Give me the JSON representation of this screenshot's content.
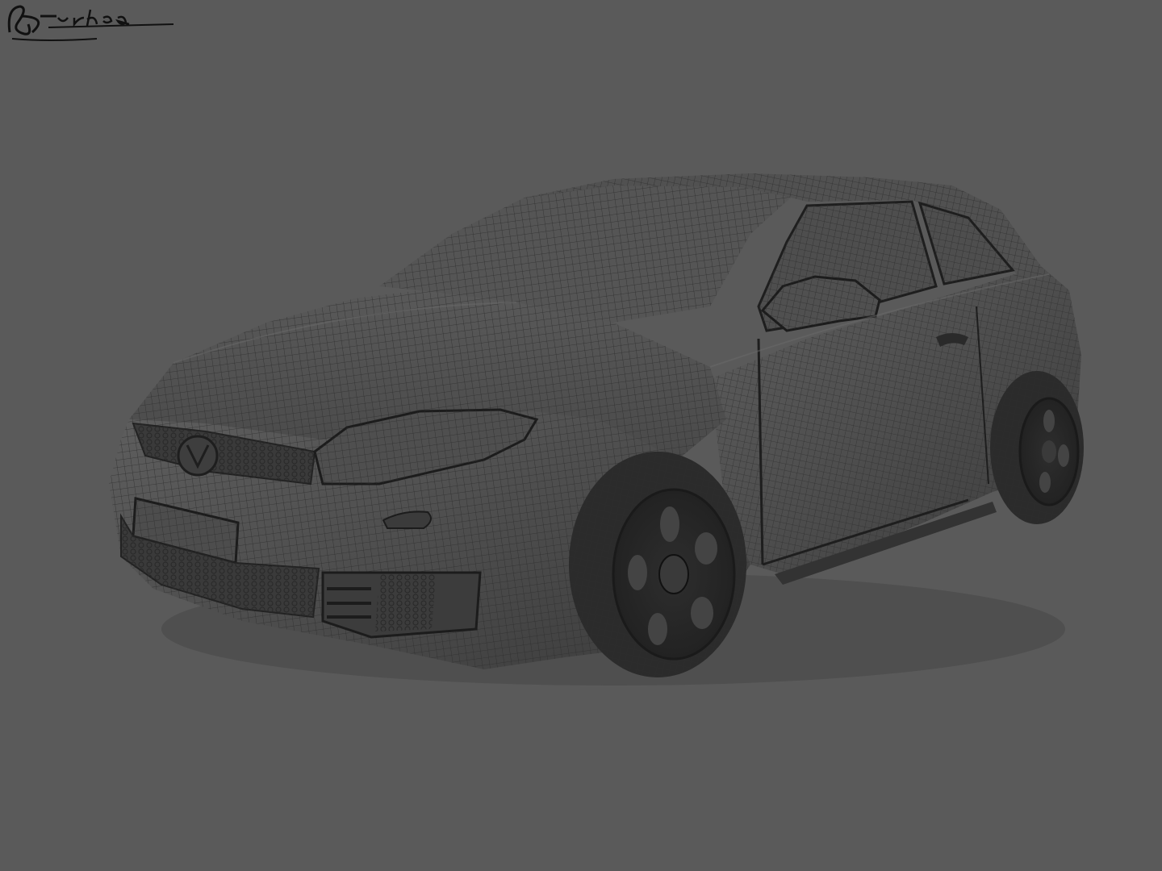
{
  "scene": {
    "subject": "car-wireframe-render",
    "background_color": "#5a5a5a",
    "body_color": "#4a4a4a",
    "wire_color": "#2e2e2e",
    "highlight_color": "#6a6a6a"
  },
  "signature": {
    "text": "Burlea",
    "color": "#111111"
  }
}
